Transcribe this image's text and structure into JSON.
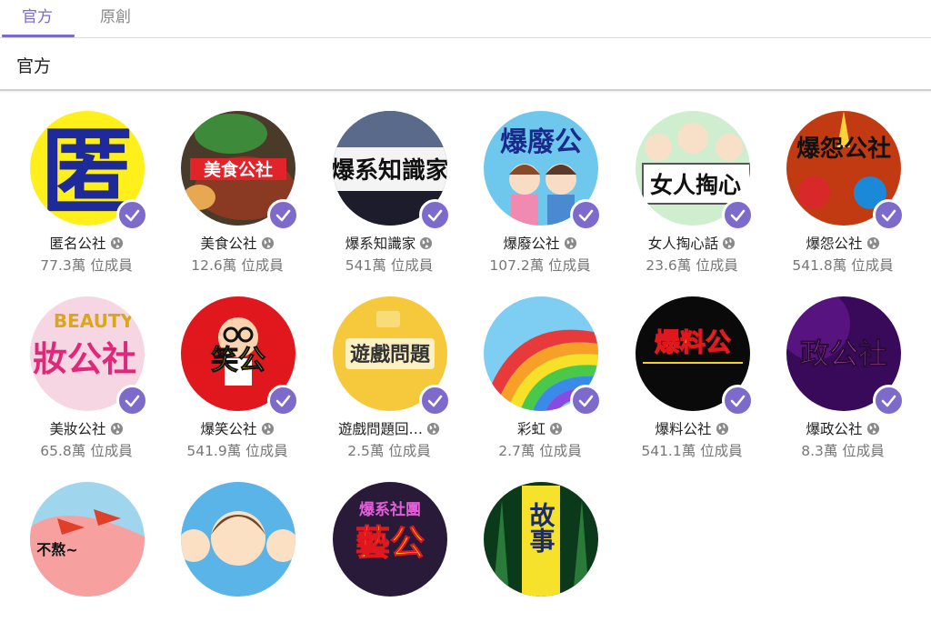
{
  "tabs": [
    {
      "label": "官方",
      "active": true
    },
    {
      "label": "原創",
      "active": false
    }
  ],
  "section": {
    "title": "官方"
  },
  "colors": {
    "accent": "#7d6bcc",
    "tab_active": "#7a6ac9",
    "text_secondary": "#777777"
  },
  "clubs": [
    {
      "name": "匿名公社",
      "members": "77.3萬 位成員",
      "avatar_text": "匿"
    },
    {
      "name": "美食公社",
      "members": "12.6萬 位成員",
      "avatar_text": "美食公社"
    },
    {
      "name": "爆系知識家",
      "members": "541萬 位成員",
      "avatar_text": "爆系知識家"
    },
    {
      "name": "爆廢公社",
      "members": "107.2萬 位成員",
      "avatar_text": "爆廢公"
    },
    {
      "name": "女人掏心話",
      "members": "23.6萬 位成員",
      "avatar_text": "女人掏心"
    },
    {
      "name": "爆怨公社",
      "members": "541.8萬 位成員",
      "avatar_text": "爆怨公社"
    },
    {
      "name": "美妝公社",
      "members": "65.8萬 位成員",
      "avatar_text": "妝公社"
    },
    {
      "name": "爆笑公社",
      "members": "541.9萬 位成員",
      "avatar_text": "笑公"
    },
    {
      "name": "遊戲問題回…",
      "members": "2.5萬 位成員",
      "avatar_text": "遊戲問題"
    },
    {
      "name": "彩虹",
      "members": "2.7萬 位成員",
      "avatar_text": ""
    },
    {
      "name": "爆料公社",
      "members": "541.1萬 位成員",
      "avatar_text": "爆料公"
    },
    {
      "name": "爆政公社",
      "members": "8.3萬 位成員",
      "avatar_text": "政公社"
    },
    {
      "name": "",
      "members": "",
      "avatar_text": "不熬~"
    },
    {
      "name": "",
      "members": "",
      "avatar_text": ""
    },
    {
      "name": "",
      "members": "",
      "avatar_text": "爆系社團"
    },
    {
      "name": "",
      "members": "",
      "avatar_text": "故事"
    }
  ]
}
